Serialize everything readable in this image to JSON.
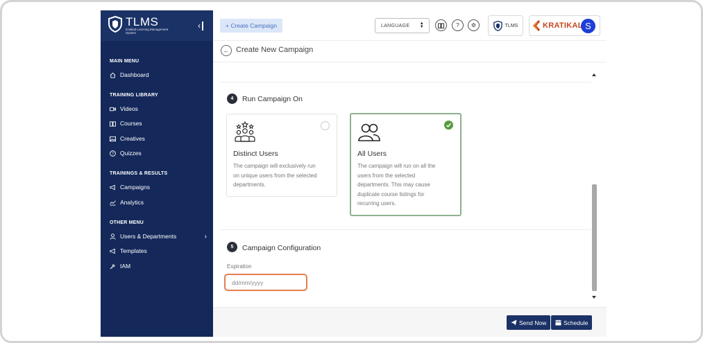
{
  "sidebar": {
    "logo_title": "TLMS",
    "logo_sub": "Kratikal Learning Management System",
    "sections": {
      "main": "MAIN MENU",
      "library": "TRAINING LIBRARY",
      "trainings": "TRAININGS & RESULTS",
      "other": "OTHER MENU"
    },
    "items": {
      "dashboard": "Dashboard",
      "videos": "Videos",
      "courses": "Courses",
      "creatives": "Creatives",
      "quizzes": "Quizzes",
      "campaigns": "Campaigns",
      "analytics": "Analytics",
      "users": "Users & Departments",
      "templates": "Templates",
      "iam": "IAM"
    }
  },
  "topbar": {
    "create_label": "+ Create Campaign",
    "language_value": "LANGUAGE",
    "tlms_chip": "TLMS",
    "org_logo_text": "KRATIKAL",
    "avatar_initial": "S"
  },
  "page": {
    "subtitle": "Create New Campaign"
  },
  "step4": {
    "number": "4",
    "title": "Run Campaign On",
    "options": [
      {
        "title": "Distinct Users",
        "desc": [
          "The campaign will exclusively run",
          "on unique users from the selected",
          "departments."
        ],
        "selected": false
      },
      {
        "title": "All Users",
        "desc": [
          "The campaign will run on all the",
          "users from the selected",
          "departments. This may cause",
          "duplicate course listings for",
          "recurring users."
        ],
        "selected": true
      }
    ]
  },
  "step5": {
    "number": "5",
    "title": "Campaign Configuration",
    "expiration_label": "Expiration",
    "expiration_placeholder": "dd/mm/yyyy"
  },
  "footer": {
    "send_now": "Send Now",
    "schedule": "Schedule"
  },
  "colors": {
    "sidebar_bg": "#14285a",
    "accent": "#1b3266",
    "selected_border": "#8fb08f",
    "check_green": "#5a9a3e",
    "focus_orange": "#e37f4e",
    "avatar_blue": "#1e3fd6"
  }
}
